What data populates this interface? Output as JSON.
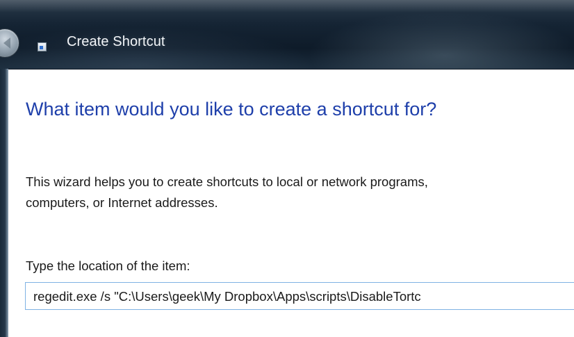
{
  "window": {
    "title": "Create Shortcut",
    "back_icon": "back-arrow-icon",
    "app_icon": "shortcut-icon"
  },
  "main": {
    "heading": "What item would you like to create a shortcut for?",
    "description_line1": "This wizard helps you to create shortcuts to local or network programs,",
    "description_line2": "computers, or Internet addresses.",
    "location_label": "Type the location of the item:",
    "location_value": "regedit.exe /s \"C:\\Users\\geek\\My Dropbox\\Apps\\scripts\\DisableTortc"
  },
  "colors": {
    "heading": "#1e3faa",
    "input_border": "#7fb2e4",
    "titlebar": "#152434"
  }
}
